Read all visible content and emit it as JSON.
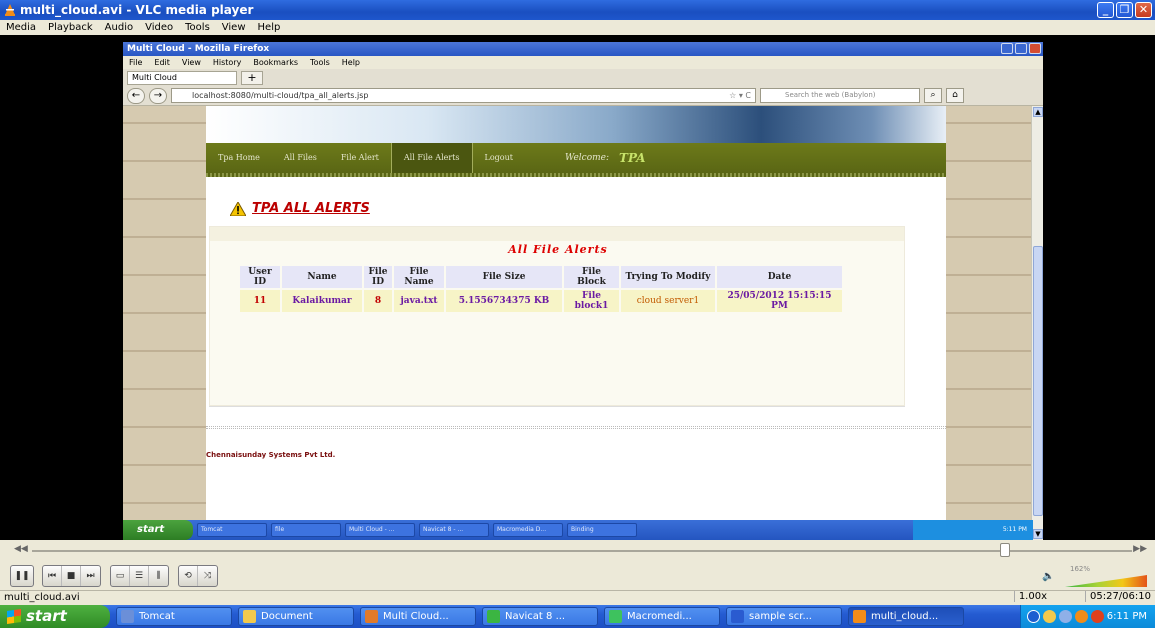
{
  "vlc": {
    "title": "multi_cloud.avi - VLC media player",
    "menu": [
      "Media",
      "Playback",
      "Audio",
      "Video",
      "Tools",
      "View",
      "Help"
    ],
    "status_file": "multi_cloud.avi",
    "speed": "1.00x",
    "time": "05:27/06:10",
    "volume_pct": "162%",
    "seek_fraction": 0.88
  },
  "firefox": {
    "title": "Multi Cloud - Mozilla Firefox",
    "menu": [
      "File",
      "Edit",
      "View",
      "History",
      "Bookmarks",
      "Tools",
      "Help"
    ],
    "tab_label": "Multi Cloud",
    "tab_add": "+",
    "url": "localhost:8080/multi-cloud/tpa_all_alerts.jsp",
    "search_placeholder": "Search the web (Babylon)"
  },
  "page": {
    "nav": [
      "Tpa Home",
      "All Files",
      "File Alert",
      "All File Alerts",
      "Logout"
    ],
    "active_nav_index": 3,
    "welcome_label": "Welcome:",
    "welcome_user": "TPA",
    "heading": "TPA ALL ALERTS",
    "alerts_title": "All File Alerts",
    "table": {
      "headers": [
        "User ID",
        "Name",
        "File ID",
        "File Name",
        "File Size",
        "File Block",
        "Trying To Modify",
        "Date"
      ],
      "rows": [
        [
          "11",
          "Kalaikumar",
          "8",
          "java.txt",
          "5.1556734375 KB",
          "File block1",
          "cloud server1",
          "25/05/2012 15:15:15 PM"
        ]
      ]
    },
    "footer": "Chennaisunday Systems Pvt Ltd."
  },
  "inner_taskbar": {
    "start": "start",
    "items": [
      "Tomcat",
      "file",
      "Multi Cloud - ...",
      "Navicat 8 - ...",
      "Macromedia D...",
      "Binding"
    ],
    "clock": "5:11 PM"
  },
  "taskbar": {
    "start": "start",
    "items": [
      {
        "label": "Tomcat",
        "icon": "tomcat-icon",
        "color": "#6b8fd8"
      },
      {
        "label": "Document",
        "icon": "folder-icon",
        "color": "#f2c94c"
      },
      {
        "label": "Multi Cloud...",
        "icon": "firefox-icon",
        "color": "#e07a2a"
      },
      {
        "label": "Navicat 8 ...",
        "icon": "navicat-icon",
        "color": "#3bb542"
      },
      {
        "label": "Macromedi...",
        "icon": "dreamweaver-icon",
        "color": "#3ec25e"
      },
      {
        "label": "sample scr...",
        "icon": "word-icon",
        "color": "#2a5bd0"
      },
      {
        "label": "multi_cloud...",
        "icon": "vlc-icon",
        "color": "#f28c18"
      }
    ],
    "clock": "6:11 PM"
  }
}
